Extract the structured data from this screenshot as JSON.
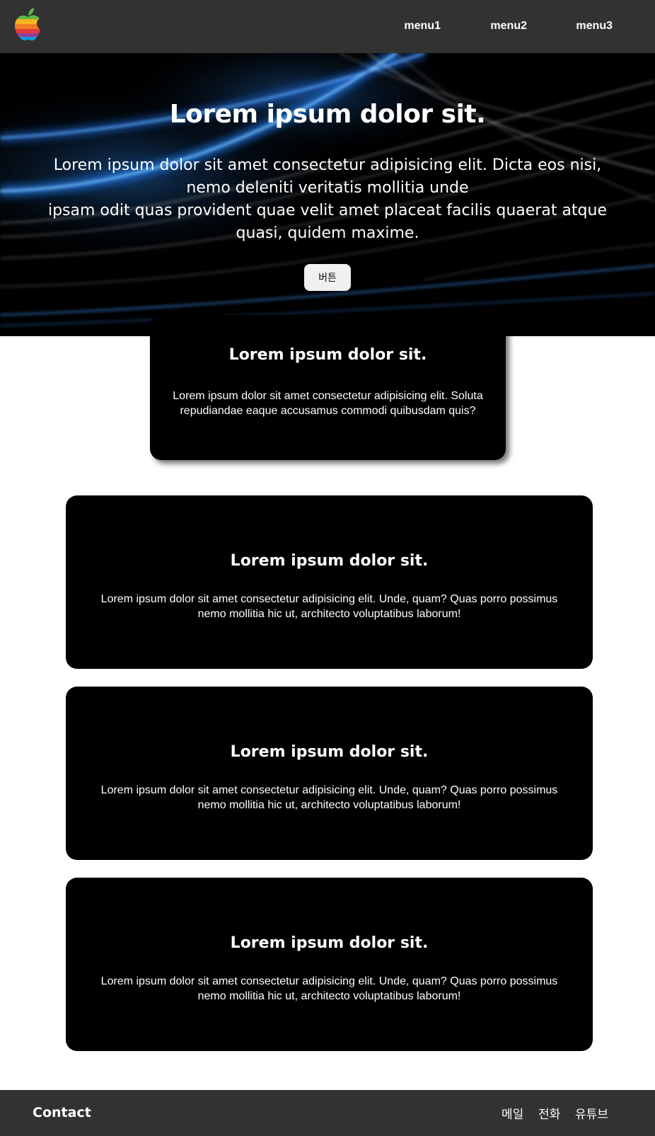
{
  "header": {
    "menu": [
      "menu1",
      "menu2",
      "menu3"
    ]
  },
  "hero": {
    "title": "Lorem ipsum dolor sit.",
    "text_line1": "Lorem ipsum dolor sit amet consectetur adipisicing elit. Dicta eos nisi, nemo deleniti veritatis mollitia unde",
    "text_line2": "ipsam odit quas provident quae velit amet placeat facilis quaerat atque quasi, quidem maxime.",
    "button_label": "버튼"
  },
  "feature_card": {
    "title": "Lorem ipsum dolor sit.",
    "text": "Lorem ipsum dolor sit amet consectetur adipisicing elit. Soluta repudiandae eaque accusamus commodi quibusdam quis?"
  },
  "cards": [
    {
      "title": "Lorem ipsum dolor sit.",
      "text": "Lorem ipsum dolor sit amet consectetur adipisicing elit. Unde, quam? Quas porro possimus nemo mollitia hic ut, architecto voluptatibus laborum!"
    },
    {
      "title": "Lorem ipsum dolor sit.",
      "text": "Lorem ipsum dolor sit amet consectetur adipisicing elit. Unde, quam? Quas porro possimus nemo mollitia hic ut, architecto voluptatibus laborum!"
    },
    {
      "title": "Lorem ipsum dolor sit.",
      "text": "Lorem ipsum dolor sit amet consectetur adipisicing elit. Unde, quam? Quas porro possimus nemo mollitia hic ut, architecto voluptatibus laborum!"
    }
  ],
  "footer": {
    "title": "Contact",
    "links": [
      "메일",
      "전화",
      "유튜브"
    ]
  },
  "colors": {
    "header_bg": "#323232",
    "card_bg": "#000000",
    "button_bg": "#f0f0f0"
  }
}
